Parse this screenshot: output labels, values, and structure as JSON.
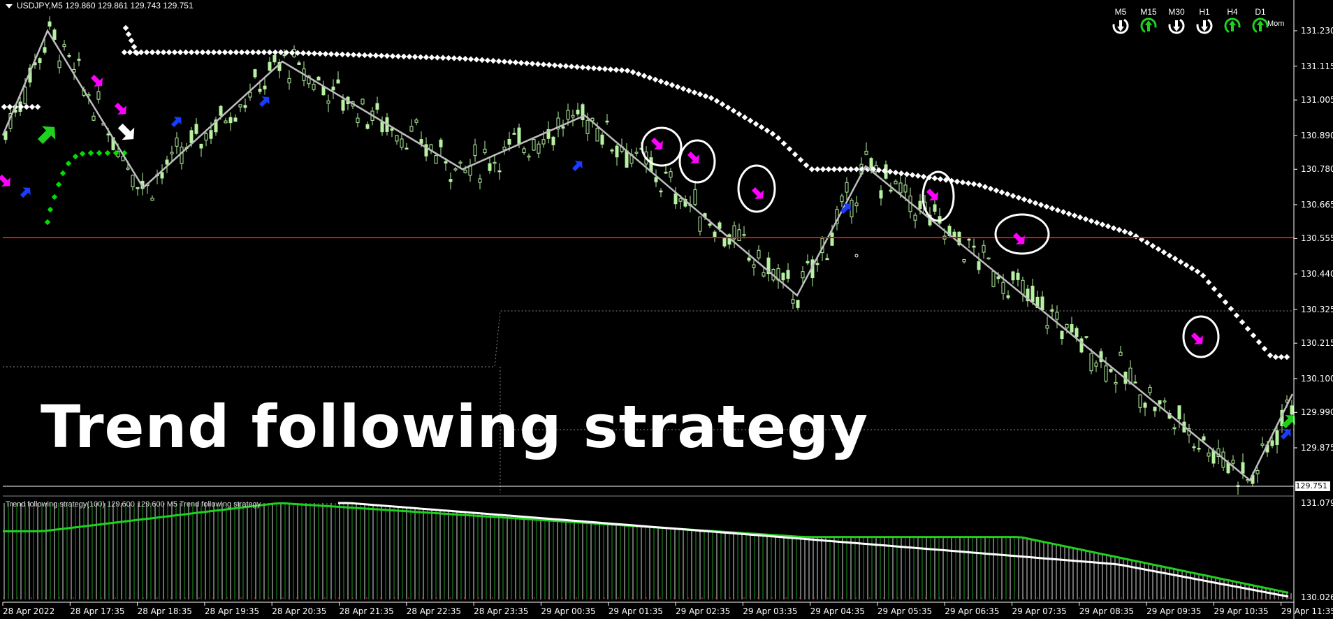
{
  "window": {
    "symbol_header": "USDJPY,M5  129.860 129.861 129.743 129.751"
  },
  "indicator": {
    "header": "Trend following strategy(100) 129.600 129.600  M5 Trend following strategy"
  },
  "overlay_title": "Trend following strategy",
  "price_axis": [
    "131.230",
    "131.115",
    "131.005",
    "130.890",
    "130.780",
    "130.665",
    "130.555",
    "130.440",
    "130.325",
    "130.215",
    "130.100",
    "129.990",
    "129.875"
  ],
  "current_price": "129.751",
  "indicator_axis": [
    "131.079",
    "130.026"
  ],
  "time_axis": [
    "28 Apr 2022",
    "28 Apr 17:35",
    "28 Apr 18:35",
    "28 Apr 19:35",
    "28 Apr 20:35",
    "28 Apr 21:35",
    "28 Apr 22:35",
    "28 Apr 23:35",
    "29 Apr 00:35",
    "29 Apr 01:35",
    "29 Apr 02:35",
    "29 Apr 03:35",
    "29 Apr 04:35",
    "29 Apr 05:35",
    "29 Apr 06:35",
    "29 Apr 07:35",
    "29 Apr 08:35",
    "29 Apr 09:35",
    "29 Apr 10:35",
    "29 Apr 11:35"
  ],
  "timeframes": [
    {
      "label": "M5",
      "state": "down"
    },
    {
      "label": "M15",
      "state": "up"
    },
    {
      "label": "M30",
      "state": "down"
    },
    {
      "label": "H1",
      "state": "down"
    },
    {
      "label": "H4",
      "state": "up"
    },
    {
      "label": "D1",
      "state": "up"
    }
  ],
  "mom_label": "Mom",
  "colors": {
    "background": "#000000",
    "candle": "#b6f2a1",
    "zigzag": "#bdbdbd",
    "support_line": "#ff0000",
    "dots_white": "#ffffff",
    "dots_green": "#00e000",
    "arrow_magenta": "#ff00ff",
    "arrow_blue": "#1a3cff",
    "indicator_green": "#1fd11f",
    "indicator_white": "#ffffff"
  },
  "chart_data": {
    "type": "candlestick",
    "symbol": "USDJPY",
    "timeframe": "M5",
    "horizontal_line_price": 130.555,
    "zigzag_prices": [
      130.89,
      131.23,
      130.72,
      131.13,
      130.78,
      130.955,
      130.37,
      130.79,
      129.77,
      130.05
    ],
    "resistance_dots_prices": [
      131.16,
      131.16,
      131.14,
      131.1,
      131.01,
      130.89,
      130.78,
      130.78,
      130.73,
      130.57,
      130.44,
      130.17
    ],
    "indicator_range": [
      130.026,
      131.079
    ]
  }
}
